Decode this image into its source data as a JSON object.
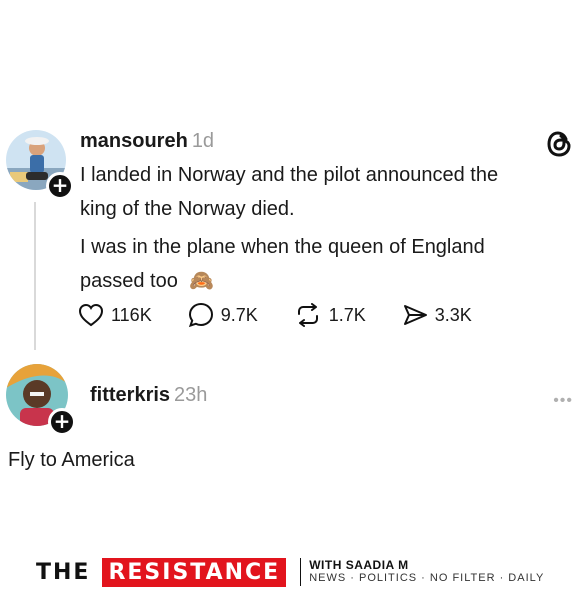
{
  "post": {
    "username": "mansoureh",
    "time": "1d",
    "line1": "I landed in Norway and the pilot announced the",
    "line2": "king of the Norway died.",
    "line3": "I was in the plane when the queen of England",
    "line4": "passed too",
    "emoji": "🙈",
    "likes": "116K",
    "replies": "9.7K",
    "reposts": "1.7K",
    "shares": "3.3K"
  },
  "reply": {
    "username": "fitterkris",
    "time": "23h",
    "text": "Fly to America"
  },
  "footer": {
    "the": "THE",
    "resistance": "RESISTANCE",
    "with": "WITH SAADIA M",
    "tagline": "NEWS · POLITICS · NO FILTER · DAILY"
  },
  "icons": {
    "logo": "threads-logo-icon",
    "like": "heart-icon",
    "reply": "comment-icon",
    "repost": "repost-icon",
    "share": "send-icon",
    "more": "more-icon"
  },
  "colors": {
    "brand_red": "#e2141d",
    "muted": "#9a9a9a"
  }
}
